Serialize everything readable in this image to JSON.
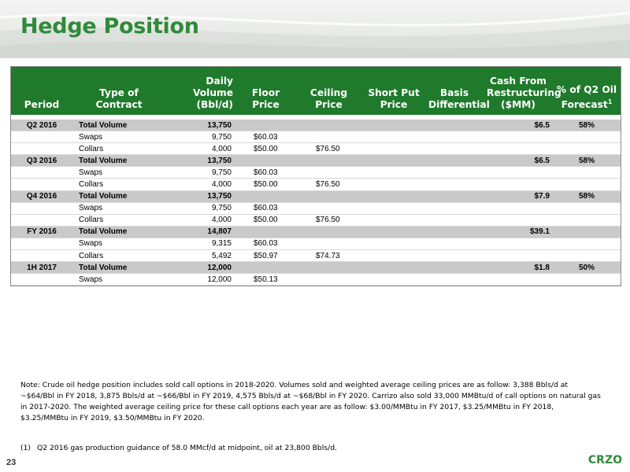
{
  "page": {
    "title": "Hedge Position",
    "page_number": "23",
    "logo_text": "CRZO"
  },
  "table": {
    "headers": {
      "period": "Period",
      "type": "Type of Contract",
      "daily_volume_1": "Daily Volume",
      "daily_volume_2": "(Bbl/d)",
      "floor": "Floor Price",
      "ceiling": "Ceiling Price",
      "short_put_1": "Short Put",
      "short_put_2": "Price",
      "basis_1": "Basis",
      "basis_2": "Differential",
      "cash_1": "Cash From",
      "cash_2": "Restructuring",
      "cash_3": "($MM)",
      "pct_1": "% of Q2 Oil",
      "pct_2": "Forecast",
      "pct_sup": "1"
    },
    "rows": [
      {
        "kind": "total",
        "period": "Q2 2016",
        "type": "Total Volume",
        "volume": "13,750",
        "floor": "",
        "ceiling": "",
        "cash": "$6.5",
        "pct": "58%"
      },
      {
        "kind": "item",
        "period": "",
        "type": "Swaps",
        "volume": "9,750",
        "floor": "$60.03",
        "ceiling": "",
        "cash": "",
        "pct": ""
      },
      {
        "kind": "item",
        "period": "",
        "type": "Collars",
        "volume": "4,000",
        "floor": "$50.00",
        "ceiling": "$76.50",
        "cash": "",
        "pct": ""
      },
      {
        "kind": "total",
        "period": "Q3 2016",
        "type": "Total Volume",
        "volume": "13,750",
        "floor": "",
        "ceiling": "",
        "cash": "$6.5",
        "pct": "58%"
      },
      {
        "kind": "item",
        "period": "",
        "type": "Swaps",
        "volume": "9,750",
        "floor": "$60.03",
        "ceiling": "",
        "cash": "",
        "pct": ""
      },
      {
        "kind": "item",
        "period": "",
        "type": "Collars",
        "volume": "4,000",
        "floor": "$50.00",
        "ceiling": "$76.50",
        "cash": "",
        "pct": ""
      },
      {
        "kind": "total",
        "period": "Q4 2016",
        "type": "Total Volume",
        "volume": "13,750",
        "floor": "",
        "ceiling": "",
        "cash": "$7.9",
        "pct": "58%"
      },
      {
        "kind": "item",
        "period": "",
        "type": "Swaps",
        "volume": "9,750",
        "floor": "$60.03",
        "ceiling": "",
        "cash": "",
        "pct": ""
      },
      {
        "kind": "item",
        "period": "",
        "type": "Collars",
        "volume": "4,000",
        "floor": "$50.00",
        "ceiling": "$76.50",
        "cash": "",
        "pct": ""
      },
      {
        "kind": "total",
        "period": "FY 2016",
        "type": "Total Volume",
        "volume": "14,807",
        "floor": "",
        "ceiling": "",
        "cash": "$39.1",
        "pct": ""
      },
      {
        "kind": "item",
        "period": "",
        "type": "Swaps",
        "volume": "9,315",
        "floor": "$60.03",
        "ceiling": "",
        "cash": "",
        "pct": ""
      },
      {
        "kind": "item",
        "period": "",
        "type": "Collars",
        "volume": "5,492",
        "floor": "$50.97",
        "ceiling": "$74.73",
        "cash": "",
        "pct": ""
      },
      {
        "kind": "total",
        "period": "1H 2017",
        "type": "Total Volume",
        "volume": "12,000",
        "floor": "",
        "ceiling": "",
        "cash": "$1.8",
        "pct": "50%"
      },
      {
        "kind": "item",
        "period": "",
        "type": "Swaps",
        "volume": "12,000",
        "floor": "$50.13",
        "ceiling": "",
        "cash": "",
        "pct": ""
      }
    ]
  },
  "notes": {
    "main": "Note: Crude oil hedge position includes sold call options in 2018-2020. Volumes sold and weighted average ceiling prices are as follow: 3,388 Bbls/d at ~$64/Bbl in FY 2018, 3,875 Bbls/d at ~$66/Bbl in FY 2019, 4,575 Bbls/d at ~$68/Bbl in FY 2020. Carrizo also sold 33,000 MMBtu/d of call options on natural gas in 2017-2020. The weighted average ceiling price for these call options each year are as follow: $3.00/MMBtu in FY 2017, $3.25/MMBtu in FY 2018, $3.25/MMBtu in FY 2019, $3.50/MMBtu in FY 2020.",
    "footnote_number": "(1)",
    "footnote_text": "Q2 2016 gas production guidance of 58.0 MMcf/d at midpoint, oil at 23,800 Bbls/d."
  },
  "colors": {
    "brand_green": "#2f8a3a",
    "header_green": "#1f7a2c",
    "total_row_gray": "#c9c9c9"
  }
}
